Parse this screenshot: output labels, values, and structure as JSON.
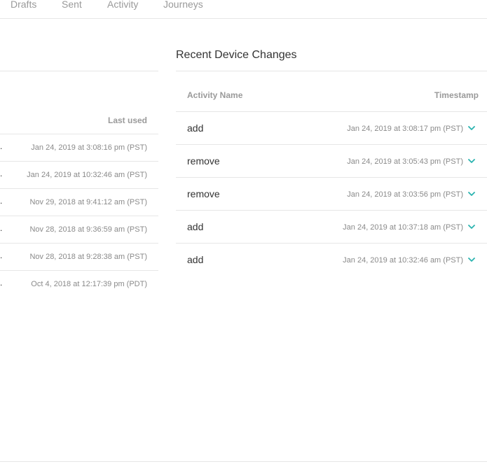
{
  "tabs": [
    {
      "label": "Drafts"
    },
    {
      "label": "Sent"
    },
    {
      "label": "Activity"
    },
    {
      "label": "Journeys"
    }
  ],
  "left_panel": {
    "column_header": "Last used",
    "rows": [
      {
        "marker": ".",
        "timestamp": "Jan 24, 2019 at 3:08:16 pm (PST)"
      },
      {
        "marker": ".",
        "timestamp": "Jan 24, 2019 at 10:32:46 am (PST)"
      },
      {
        "marker": ".",
        "timestamp": "Nov 29, 2018 at 9:41:12 am (PST)"
      },
      {
        "marker": ".",
        "timestamp": "Nov 28, 2018 at 9:36:59 am (PST)"
      },
      {
        "marker": ".",
        "timestamp": "Nov 28, 2018 at 9:28:38 am (PST)"
      },
      {
        "marker": ".",
        "timestamp": "Oct 4, 2018 at 12:17:39 pm (PDT)"
      }
    ]
  },
  "right_panel": {
    "title": "Recent Device Changes",
    "columns": {
      "activity": "Activity Name",
      "timestamp": "Timestamp"
    },
    "rows": [
      {
        "name": "add",
        "timestamp": "Jan 24, 2019 at 3:08:17 pm (PST)",
        "icon": "chevron-down-icon"
      },
      {
        "name": "remove",
        "timestamp": "Jan 24, 2019 at 3:05:43 pm (PST)",
        "icon": "chevron-down-icon"
      },
      {
        "name": "remove",
        "timestamp": "Jan 24, 2019 at 3:03:56 pm (PST)",
        "icon": "chevron-down-icon"
      },
      {
        "name": "add",
        "timestamp": "Jan 24, 2019 at 10:37:18 am (PST)",
        "icon": "chevron-down-icon"
      },
      {
        "name": "add",
        "timestamp": "Jan 24, 2019 at 10:32:46 am (PST)",
        "icon": "chevron-down-icon"
      }
    ]
  },
  "colors": {
    "accent": "#2bb3b0",
    "muted_text": "#9a9a9a",
    "divider": "#e6e6e6"
  }
}
